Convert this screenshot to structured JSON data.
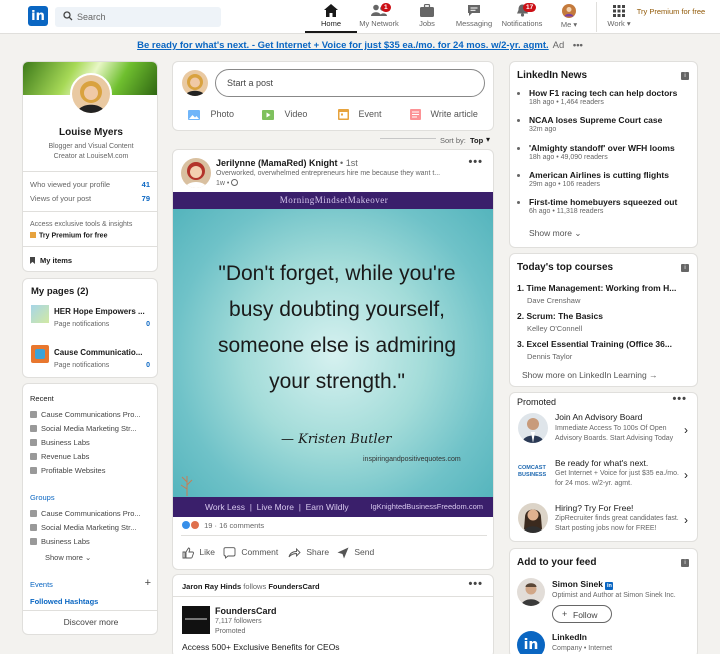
{
  "nav": {
    "search_placeholder": "Search",
    "items": [
      {
        "label": "Home"
      },
      {
        "label": "My Network",
        "badge": "1"
      },
      {
        "label": "Jobs"
      },
      {
        "label": "Messaging"
      },
      {
        "label": "Notifications",
        "badge": "17"
      },
      {
        "label": "Me"
      },
      {
        "label": "Work"
      }
    ],
    "premium": "Try Premium for free"
  },
  "ad_banner": {
    "text": "Be ready for what's next. - Get Internet + Voice for just $35 ea./mo. for 24 mos. w/2-yr. agmt.",
    "tag": "Ad"
  },
  "profile": {
    "name": "Louise Myers",
    "headline": "Blogger and Visual Content Creator at LouiseM.com",
    "stats": [
      {
        "label": "Who viewed your profile",
        "value": "41"
      },
      {
        "label": "Views of your post",
        "value": "79"
      }
    ],
    "premium_note": "Access exclusive tools & insights",
    "premium_link": "Try Premium for free",
    "my_items": "My items"
  },
  "pages": {
    "title": "My pages (2)",
    "items": [
      {
        "name": "HER Hope Empowers ...",
        "sub": "Page notifications",
        "count": "0"
      },
      {
        "name": "Cause Communicatio...",
        "sub": "Page notifications",
        "count": "0"
      }
    ]
  },
  "recent": {
    "title": "Recent",
    "items": [
      "Cause Communications Pro...",
      "Social Media Marketing Str...",
      "Business Labs",
      "Revenue Labs",
      "Profitable Websites"
    ],
    "groups_title": "Groups",
    "groups": [
      "Cause Communications Pro...",
      "Social Media Marketing Str...",
      "Business Labs"
    ],
    "show_more": "Show more",
    "events": "Events",
    "hashtags": "Followed Hashtags",
    "discover": "Discover more"
  },
  "composer": {
    "placeholder": "Start a post",
    "actions": [
      "Photo",
      "Video",
      "Event",
      "Write article"
    ]
  },
  "sort": {
    "label": "Sort by:",
    "value": "Top"
  },
  "post": {
    "author": "Jerilynne (MamaRed) Knight",
    "degree": "• 1st",
    "subtitle": "Overworked, overwhelmed entrepreneurs hire me because they want t...",
    "time": "1w •",
    "image_header": "MorningMindsetMakeover",
    "quote": "\"Don't forget, while you're busy doubting yourself, someone else is admiring your strength.\"",
    "quote_author": "— Kristen Butler",
    "credit": "inspiringandpositivequotes.com",
    "footer_left": "Work Less  |  Live More  |  Earn Wildly",
    "footer_right": "IgKnightedBusinessFreedom.com",
    "reactions": "19 · 16 comments",
    "actions": [
      "Like",
      "Comment",
      "Share",
      "Send"
    ]
  },
  "post2": {
    "header_actor": "Jaron Ray Hinds",
    "header_verb": "follows",
    "header_target": "FoundersCard",
    "company": "FoundersCard",
    "followers": "7,117 followers",
    "promoted": "Promoted",
    "headline": "Access 500+ Exclusive Benefits for CEOs"
  },
  "news": {
    "title": "LinkedIn News",
    "items": [
      {
        "title": "How F1 racing tech can help doctors",
        "meta": "18h ago • 1,464 readers"
      },
      {
        "title": "NCAA loses Supreme Court case",
        "meta": "32m ago"
      },
      {
        "title": "'Almighty standoff' over WFH looms",
        "meta": "18h ago • 49,090 readers"
      },
      {
        "title": "American Airlines is cutting flights",
        "meta": "29m ago • 106 readers"
      },
      {
        "title": "First-time homebuyers squeezed out",
        "meta": "6h ago • 11,318 readers"
      }
    ],
    "show_more": "Show more"
  },
  "courses": {
    "title": "Today's top courses",
    "items": [
      {
        "title": "1. Time Management: Working from H...",
        "author": "Dave Crenshaw"
      },
      {
        "title": "2. Scrum: The Basics",
        "author": "Kelley O'Connell"
      },
      {
        "title": "3. Excel Essential Training (Office 36...",
        "author": "Dennis Taylor"
      }
    ],
    "show_more": "Show more on LinkedIn Learning"
  },
  "promoted": {
    "title": "Promoted",
    "items": [
      {
        "title": "Join An Advisory Board",
        "body": "Immediate Access To 100s Of Open Advisory Boards. Start Advising Today"
      },
      {
        "title": "Be ready for what's next.",
        "body": "Get Internet + Voice for just $35 ea./mo. for 24 mos. w/2-yr. agmt.",
        "logo": "COMCAST BUSINESS"
      },
      {
        "title": "Hiring? Try For Free!",
        "body": "ZipRecruiter finds great candidates fast. Start posting jobs now for FREE!"
      }
    ]
  },
  "feed": {
    "title": "Add to your feed",
    "items": [
      {
        "name": "Simon Sinek",
        "sub": "Optimist and Author at Simon Sinek Inc.",
        "button": "Follow"
      },
      {
        "name": "LinkedIn",
        "sub": "Company • Internet"
      }
    ]
  },
  "colors": {
    "accent": "#0a66c2",
    "badge": "#cc1016",
    "premium": "#915907",
    "post_banner": "#3a1f6b"
  }
}
